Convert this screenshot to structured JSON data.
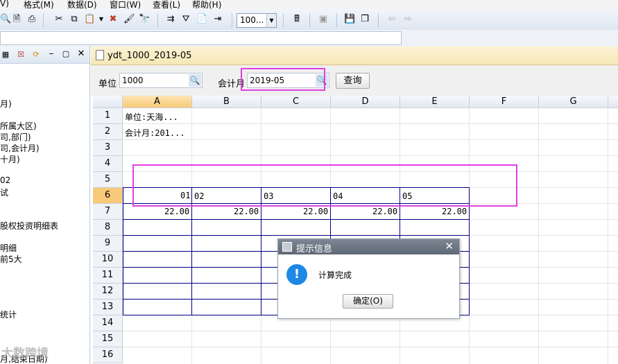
{
  "menubar": {
    "items": [
      "V)",
      "格式(M)",
      "数据(D)",
      "窗口(W)",
      "查看(L)",
      "帮助(H)"
    ]
  },
  "toolbar": {
    "zoom_value": "100...",
    "icons": [
      "search-icon",
      "print-preview-icon",
      "print-icon",
      "cut-icon",
      "copy-icon",
      "paste-icon",
      "paste-dropdown-icon",
      "delete-icon",
      "format-painter-icon",
      "find-icon",
      "insert-icon",
      "filter-icon",
      "report-icon",
      "export-icon",
      "calculator-icon",
      "stamp-icon",
      "save-icon",
      "window-icon",
      "back-arrow-icon",
      "forward-arrow-icon"
    ]
  },
  "left_panel": {
    "items": [
      "月)",
      "所属大区)",
      "司,部门)",
      "司,会计月)",
      "十月)",
      "02",
      "试",
      "股权投资明细表",
      "明细",
      "前5大",
      "统计",
      "月,结束日期)"
    ]
  },
  "document": {
    "title": "ydt_1000_2019-05"
  },
  "query": {
    "unit_label": "单位",
    "unit_value": "1000",
    "period_label": "会计月",
    "period_value": "2019-05",
    "query_button": "查询"
  },
  "sheet": {
    "columns": [
      "A",
      "B",
      "C",
      "D",
      "E",
      "F",
      "G"
    ],
    "selected_column": "A",
    "rows": [
      "1",
      "2",
      "3",
      "4",
      "5",
      "6",
      "7",
      "8",
      "9",
      "10",
      "11",
      "12",
      "13",
      "14",
      "15",
      "16"
    ],
    "selected_row": "6",
    "cells": {
      "A1": "单位:天海...",
      "A2": "会计月:201...",
      "A6": "01",
      "B6": "02",
      "C6": "03",
      "D6": "04",
      "E6": "05",
      "A7": "22.00",
      "B7": "22.00",
      "C7": "22.00",
      "D7": "22.00",
      "E7": "22.00"
    }
  },
  "dialog": {
    "title": "提示信息",
    "message": "计算完成",
    "ok_button": "确定(O)"
  },
  "watermark": "大数跨境",
  "colors": {
    "highlight_box": "#e040e0",
    "table_border": "#000080",
    "selected_header": "#f8c978",
    "info_icon": "#1e88e5"
  }
}
